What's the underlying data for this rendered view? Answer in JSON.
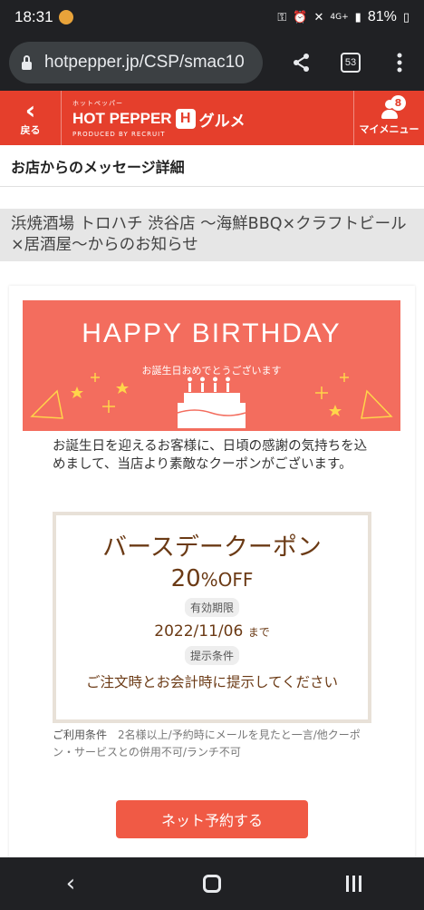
{
  "status_bar": {
    "time": "18:31",
    "network": "4G+",
    "battery": "81%"
  },
  "browser": {
    "url": "hotpepper.jp/CSP/smac10",
    "tab_count": "53"
  },
  "header": {
    "back_label": "戻る",
    "logo_small": "ホットペッパー",
    "logo_main": "HOT PEPPER",
    "logo_h": "H",
    "logo_gourmet": "グルメ",
    "logo_by": "PRODUCED BY ",
    "logo_recruit": "RECRUIT",
    "mymenu_label": "マイメニュー",
    "mymenu_badge": "8"
  },
  "page_title": "お店からのメッセージ詳細",
  "shop_name": "浜焼酒場 トロハチ 渋谷店 〜海鮮BBQ×クラフトビール×居酒屋〜からのお知らせ",
  "banner": {
    "title": "HAPPY BIRTHDAY",
    "subtitle": "お誕生日おめでとうございます",
    "color": "#f36d5e"
  },
  "message": "お誕生日を迎えるお客様に、日頃の感謝の気持ちを込めまして、当店より素敵なクーポンがございます。",
  "coupon": {
    "title": "バースデークーポン",
    "discount_number": "20",
    "discount_unit": "%OFF",
    "validity_label": "有効期限",
    "validity_date": "2022/11/06",
    "validity_suffix": "まで",
    "condition_label": "提示条件",
    "condition_text": "ご注文時とお会計時に提示してください"
  },
  "terms": {
    "label": "ご利用条件",
    "text": "2名様以上/予約時にメールを見たと一言/他クーポン・サービスとの併用不可/ランチ不可"
  },
  "reserve_button": "ネット予約する",
  "colors": {
    "brand_red": "#e53f2c",
    "button_red": "#f05a45",
    "coupon_brown": "#6b3a15"
  }
}
